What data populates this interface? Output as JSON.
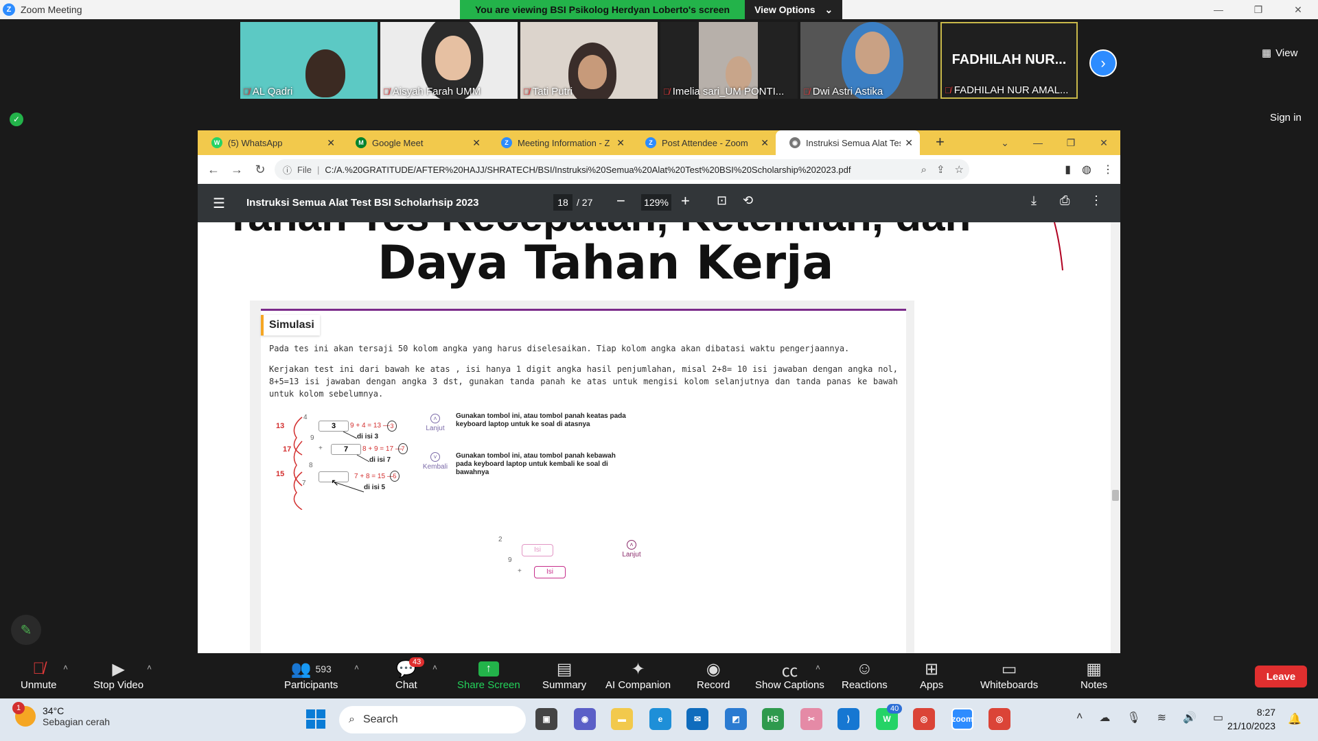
{
  "window": {
    "title": "Zoom Meeting"
  },
  "share_banner": {
    "text": "You are viewing BSI Psikolog Herdyan Loberto's screen",
    "view_options": "View Options"
  },
  "gallery": {
    "participants": [
      {
        "name": "AL Qadri",
        "bg": "#5cc9c4"
      },
      {
        "name": "Aisyah Farah UMM",
        "bg": "#e8e8e8"
      },
      {
        "name": "Tati Putri",
        "bg": "#d9d2cc"
      },
      {
        "name": "Imelia sari_UM PONTI...",
        "bg": "#2a2a2a"
      },
      {
        "name": "Dwi Astri Astika",
        "bg": "#4a4a4a"
      },
      {
        "name": "FADHILAH NUR AMAL...",
        "display": "FADHILAH NUR..."
      }
    ],
    "view_label": "View"
  },
  "sign_in": "Sign in",
  "chrome": {
    "tabs": [
      {
        "label": "(5) WhatsApp",
        "icon": "whatsapp-icon",
        "color": "#25d366",
        "glyph": "W"
      },
      {
        "label": "Google Meet",
        "icon": "google-meet-icon",
        "color": "#00832d",
        "glyph": "M"
      },
      {
        "label": "Meeting Information - Z",
        "icon": "zoom-icon",
        "color": "#2d8cff",
        "glyph": "Z"
      },
      {
        "label": "Post Attendee - Zoom",
        "icon": "zoom-icon",
        "color": "#2d8cff",
        "glyph": "Z"
      },
      {
        "label": "Instruksi Semua Alat Test",
        "icon": "globe-icon",
        "color": "#777",
        "glyph": "◉"
      }
    ],
    "address": {
      "scheme": "File",
      "url": "C:/A.%20GRATITUDE/AFTER%20HAJJ/SHRATECH/BSI/Instruksi%20Semua%20Alat%20Test%20BSI%20Scholarship%202023.pdf"
    }
  },
  "pdf": {
    "title": "Instruksi Semua Alat Test BSI Scholarhsip 2023",
    "page_current": "18",
    "page_total": "/ 27",
    "zoom": "129%",
    "heading_partial": "Tahan Tes Kecepatan, Ketelitian, dan",
    "heading": "Daya Tahan Kerja",
    "simulasi": {
      "title": "Simulasi",
      "para1": "Pada tes ini akan tersaji 50 kolom angka yang harus diselesaikan. Tiap kolom angka akan dibatasi waktu pengerjaannya.",
      "para2": "Kerjakan test ini dari bawah ke atas , isi hanya 1 digit angka hasil penjumlahan, misal 2+8= 10 isi jawaban dengan angka nol, 8+5=13 isi jawaban dengan angka 3 dst, gunakan tanda panah ke atas untuk mengisi kolom selanjutnya dan tanda panas ke bawah untuk kolom sebelumnya.",
      "diagram": {
        "sums": [
          "13",
          "17",
          "15"
        ],
        "digits": [
          "4",
          "9",
          "8",
          "7"
        ],
        "plus": "+",
        "box1": "3",
        "box2": "7",
        "box3": "",
        "eq1": "9 + 4 = 13 —",
        "c1": "3",
        "eq2": "8 + 9 = 17 —",
        "c2": "7",
        "eq3": "7 + 8 = 15 —",
        "c3": "5",
        "lbl1": "di isi 3",
        "lbl2": "di isi 7",
        "lbl3": "di isi 5"
      },
      "lanjut_label": "Lanjut",
      "kembali_label": "Kembali",
      "hint_up": "Gunakan tombol ini, atau tombol panah keatas pada keyboard laptop untuk  ke soal di atasnya",
      "hint_down": "Gunakan tombol ini, atau tombol panah kebawah pada keyboard laptop untuk kembali ke soal di bawahnya",
      "lower": {
        "d1": "2",
        "d2": "9",
        "plus": "+",
        "isi": "Isi",
        "lanjut": "Lanjut"
      }
    }
  },
  "controls": {
    "unmute": "Unmute",
    "stop_video": "Stop Video",
    "participants": "Participants",
    "participants_count": "593",
    "chat": "Chat",
    "chat_badge": "43",
    "share_screen": "Share Screen",
    "summary": "Summary",
    "ai_companion": "AI Companion",
    "record": "Record",
    "show_captions": "Show Captions",
    "reactions": "Reactions",
    "apps": "Apps",
    "whiteboards": "Whiteboards",
    "notes": "Notes",
    "leave": "Leave"
  },
  "taskbar": {
    "weather_badge": "1",
    "temp": "34°C",
    "condition": "Sebagian cerah",
    "search": "Search",
    "whatsapp_badge": "40",
    "time": "8:27",
    "date": "21/10/2023"
  }
}
